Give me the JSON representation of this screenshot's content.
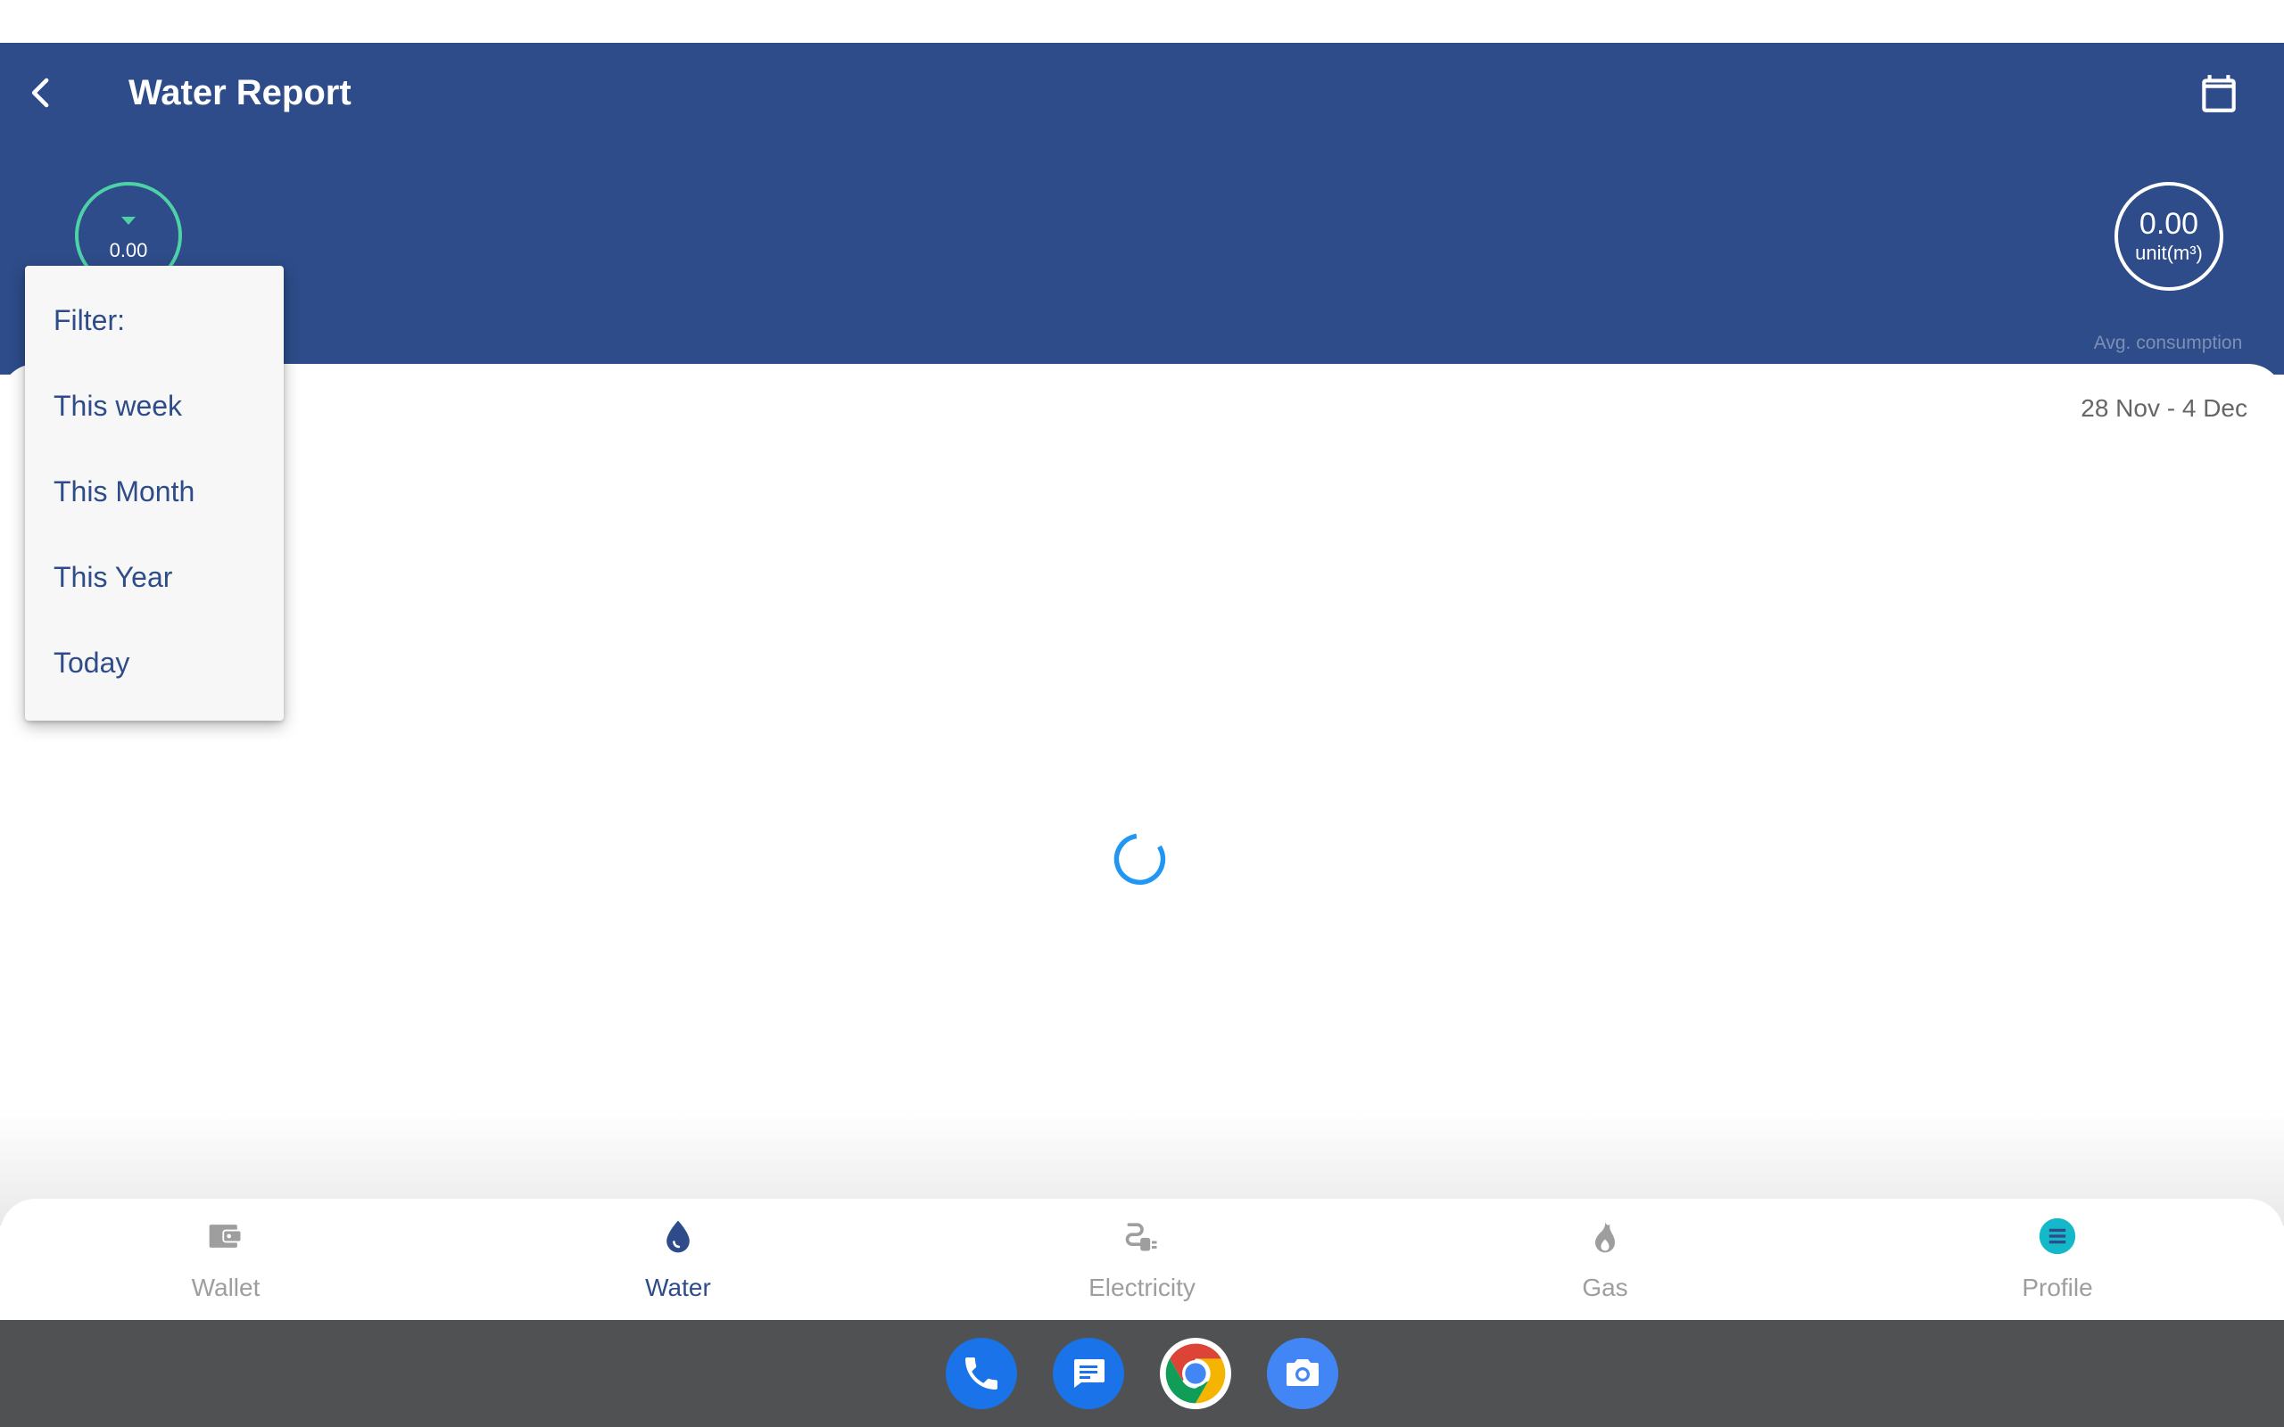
{
  "header": {
    "title": "Water Report",
    "usage_value": "0.00",
    "avg": {
      "value": "0.00",
      "unit": "unit(m³)",
      "label": "Avg. consumption"
    }
  },
  "filter_menu": {
    "header": "Filter:",
    "options": [
      "This week",
      "This Month",
      "This Year",
      "Today"
    ]
  },
  "content": {
    "date_range": "28 Nov - 4 Dec"
  },
  "bottom_nav": {
    "items": [
      {
        "label": "Wallet",
        "icon": "wallet-icon",
        "active": false
      },
      {
        "label": "Water",
        "icon": "water-drop-icon",
        "active": true
      },
      {
        "label": "Electricity",
        "icon": "plug-icon",
        "active": false
      },
      {
        "label": "Gas",
        "icon": "flame-icon",
        "active": false
      },
      {
        "label": "Profile",
        "icon": "menu-icon",
        "active": false
      }
    ]
  },
  "dock": {
    "apps": [
      "phone",
      "messages",
      "chrome",
      "camera"
    ]
  },
  "colors": {
    "header_bg": "#2d4c89",
    "accent_green": "#4fd1a6",
    "spinner": "#2196f3",
    "inactive": "#9e9e9e",
    "dock_bg": "#505153"
  }
}
